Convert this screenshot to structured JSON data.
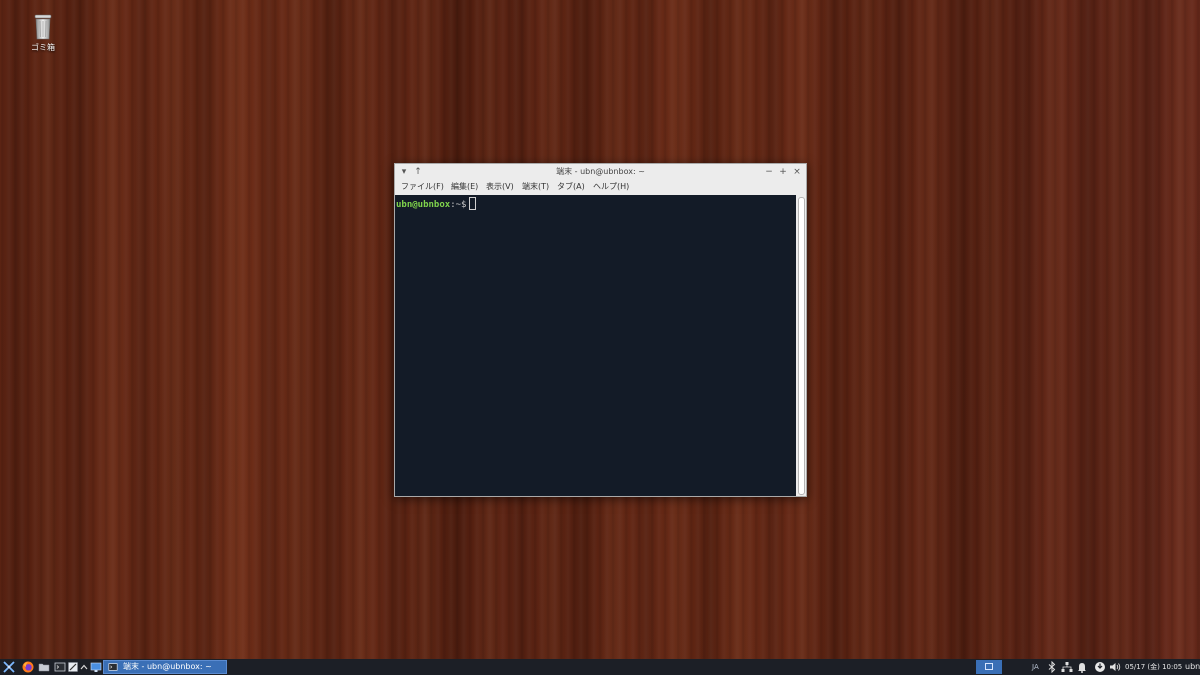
{
  "desktop": {
    "icons": [
      {
        "label": "ゴミ箱",
        "icon": "trash-icon"
      }
    ]
  },
  "terminal_window": {
    "title": "端末 - ubn@ubnbox: ~",
    "titlebar_buttons": {
      "menu": "▾",
      "stick": "↑",
      "minimize": "−",
      "maximize": "+",
      "close": "×"
    },
    "menu": [
      "ファイル(F)",
      "編集(E)",
      "表示(V)",
      "端末(T)",
      "タブ(A)",
      "ヘルプ(H)"
    ],
    "prompt_user": "ubn@ubnbox",
    "prompt_path": ":~$"
  },
  "taskbar": {
    "launchers": [
      "app-menu-icon",
      "firefox-icon",
      "file-manager-icon",
      "terminal-icon",
      "text-editor-icon",
      "show-more-icon",
      "show-desktop-icon"
    ],
    "tasks": [
      {
        "label": "端末 - ubn@ubnbox: ~",
        "icon": "terminal-icon",
        "active": true
      }
    ],
    "tray": {
      "ime": "JA",
      "icons": [
        "bluetooth-icon",
        "network-icon",
        "notification-bell-icon",
        "updates-icon",
        "volume-icon"
      ],
      "clock": "05/17 (金) 10:05",
      "user": "ubn"
    }
  },
  "colors": {
    "terminal_bg": "#131b27",
    "prompt_user": "#7fd34c",
    "taskbar_bg": "#1c1f26",
    "active_task": "#3a6fb6"
  }
}
